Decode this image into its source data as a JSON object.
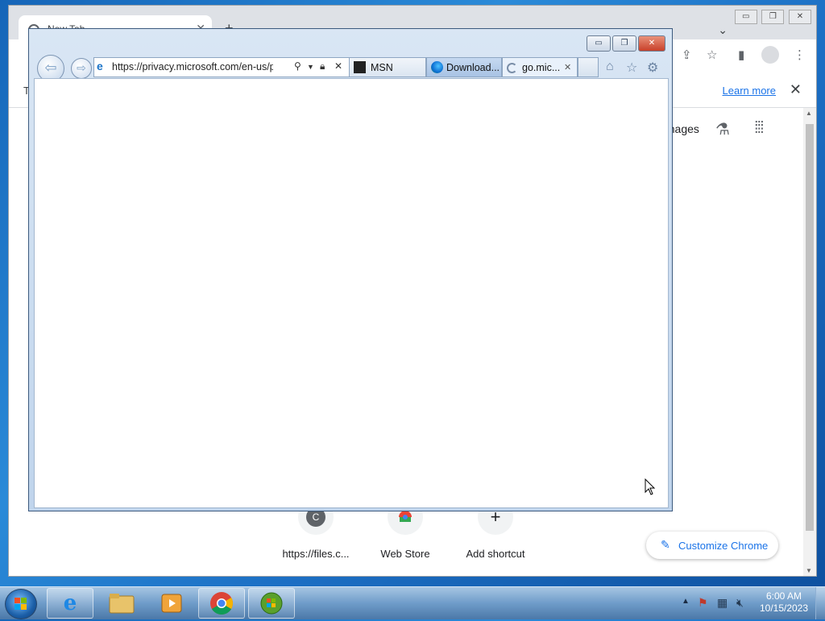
{
  "chrome": {
    "tab_title": "New Tab",
    "tab_close": "✕",
    "new_tab": "+",
    "info_text": "T",
    "learn_more": "Learn more",
    "info_close": "✕",
    "images_link": "Images",
    "shortcuts": [
      {
        "label": "https://files.c...",
        "initial": "C"
      },
      {
        "label": "Web Store",
        "initial": ""
      },
      {
        "label": "Add shortcut",
        "initial": "+"
      }
    ],
    "customize_label": "Customize Chrome",
    "window_buttons": [
      "▭",
      "❐",
      "✕"
    ]
  },
  "ie": {
    "address_url": "https://privacy.microsoft.com/en-us/priv",
    "tabs": [
      {
        "label": "MSN"
      },
      {
        "label": "Download..."
      },
      {
        "label": "go.mic..."
      }
    ],
    "tab_close": "✕",
    "window_buttons": [
      "▭",
      "❐",
      "✕"
    ]
  },
  "taskbar": {
    "clock_time": "6:00 AM",
    "clock_date": "10/15/2023",
    "pinned": [
      "internet-explorer",
      "file-explorer",
      "media-player",
      "chrome",
      "windows-update"
    ]
  },
  "colors": {
    "chrome_accent": "#1a73e8",
    "ie_frame": "#c6d9ee",
    "taskbar": "#6f9cc9"
  }
}
